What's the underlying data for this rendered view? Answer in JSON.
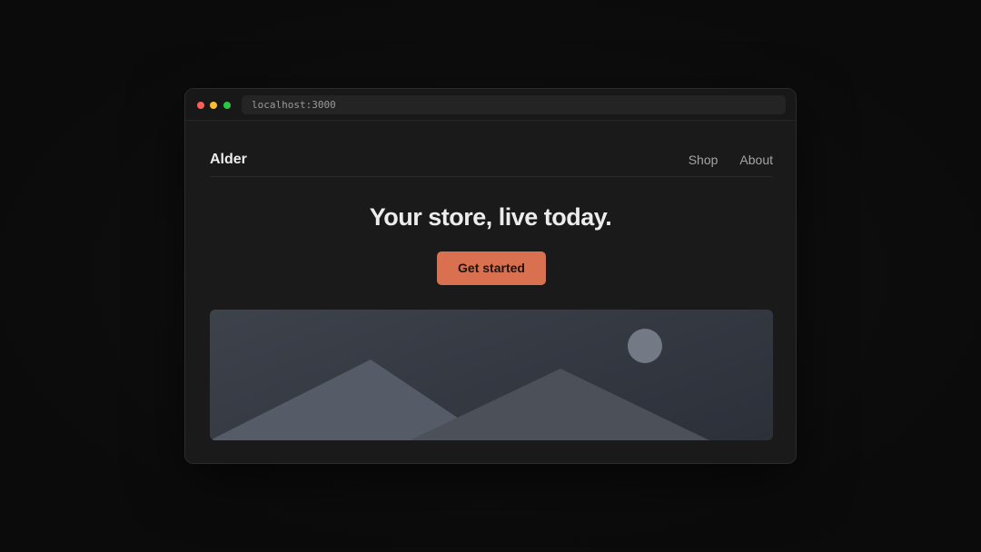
{
  "browser": {
    "url": "localhost:3000",
    "traffic_lights": [
      "close",
      "minimize",
      "maximize"
    ],
    "colors": {
      "close": "#ff5f57",
      "minimize": "#febc2e",
      "maximize": "#28c840"
    }
  },
  "site": {
    "brand": "Alder",
    "nav": [
      {
        "label": "Shop"
      },
      {
        "label": "About"
      }
    ]
  },
  "hero": {
    "title": "Your store, live today.",
    "cta_label": "Get started",
    "image_icon": "landscape-placeholder-icon"
  },
  "colors": {
    "accent": "#d9704f",
    "page_bg": "#1a1a1a",
    "text": "#ececec",
    "muted_text": "#a4a4a4"
  }
}
